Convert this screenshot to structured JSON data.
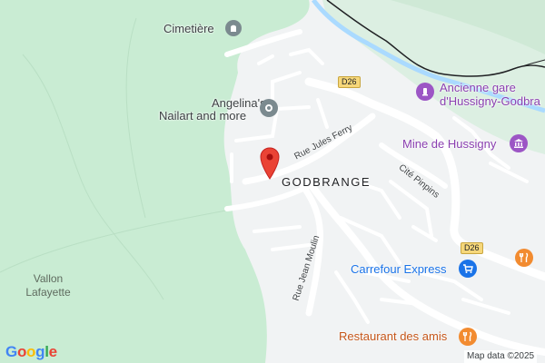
{
  "map": {
    "labels": {
      "cimetiere": "Cimetière",
      "angelinas_line1": "Angelina's",
      "angelinas_line2": "Nailart and more",
      "godbrange": "GODBRANGE",
      "rue_jules_ferry": "Rue Jules Ferry",
      "cite_pinpins": "Cité Pinpins",
      "rue_jean_moulin": "Rue Jean Moulin",
      "vallon_line1": "Vallon",
      "vallon_line2": "Lafayette",
      "ancienne_gare_line1": "Ancienne gare",
      "ancienne_gare_line2": "d'Hussigny-Godbra",
      "mine_de_hussigny": "Mine de Hussigny",
      "carrefour_express": "Carrefour Express",
      "restaurant_des_amis": "Restaurant des amis"
    },
    "road_shields": [
      "D26",
      "D26"
    ],
    "logo": "Google",
    "attribution": "Map data ©2025",
    "icons": {
      "cemetery": "cemetery-icon",
      "location_pin_grey": "grey-place-icon",
      "selected_marker": "red-location-marker-icon",
      "train_station": "train-station-icon",
      "museum": "museum-icon",
      "shopping": "shopping-cart-icon",
      "restaurant": "restaurant-fork-knife-icon"
    },
    "colors": {
      "park_green": "#c9ecd3",
      "land_gray": "#f1f3f4",
      "road_white": "#ffffff",
      "water": "#aadaff",
      "marker_red": "#ea4335",
      "poi_purple": "#8a3fb0",
      "poi_blue": "#1a73e8",
      "poi_orange": "#f28b30"
    }
  }
}
